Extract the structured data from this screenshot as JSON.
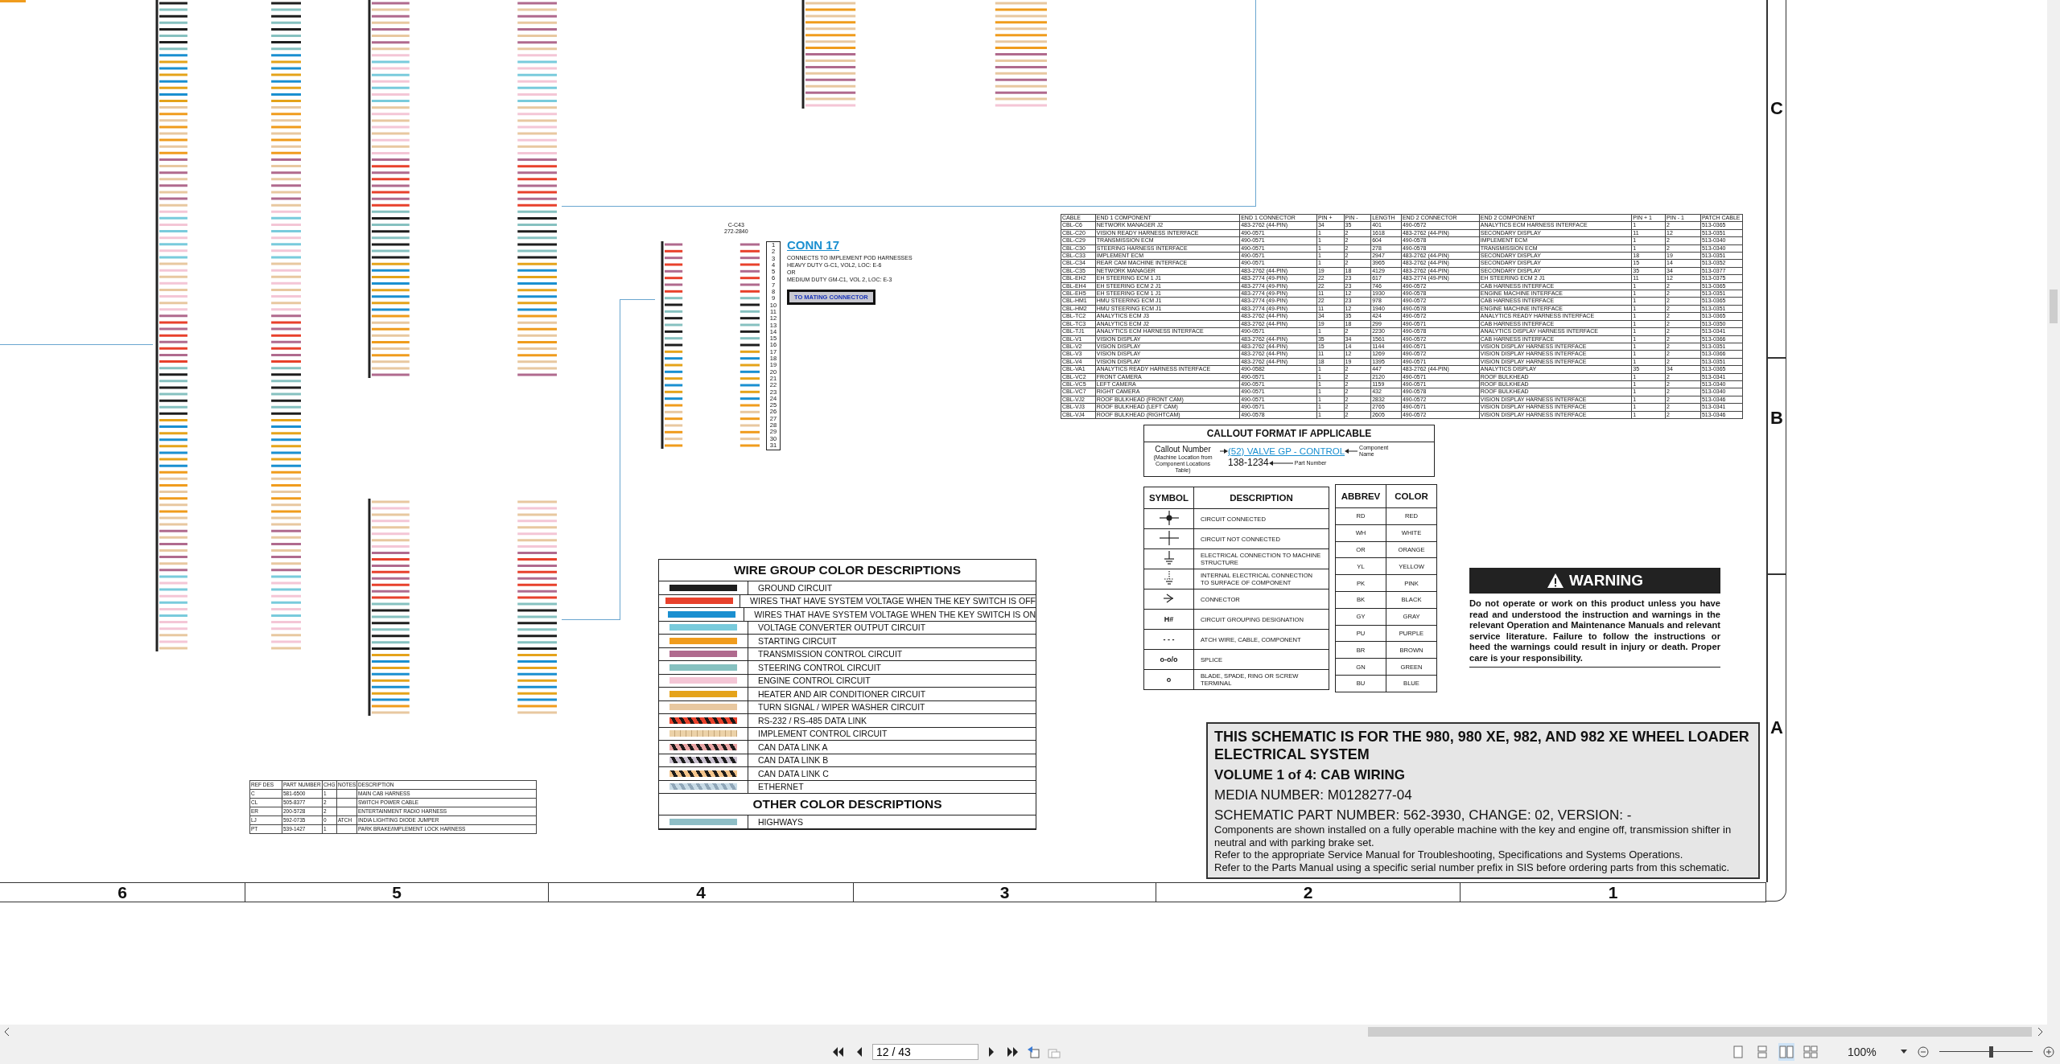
{
  "sheet": {
    "row_letters": [
      "C",
      "B",
      "A"
    ],
    "column_numbers": [
      "6",
      "5",
      "4",
      "3",
      "2",
      "1"
    ],
    "connector": {
      "ref": "C-C43",
      "part": "272-2840",
      "title": "CONN 17",
      "lines": [
        "CONNECTS TO IMPLEMENT POD HARNESSES",
        "HEAVY DUTY G-C1, VOL2, LOC: E-6",
        "OR",
        "MEDIUM DUTY GM-C1, VOL 2, LOC: E-3"
      ],
      "button": "TO MATING CONNECTOR",
      "pins": [
        "1",
        "2",
        "3",
        "4",
        "5",
        "6",
        "7",
        "8",
        "9",
        "10",
        "11",
        "12",
        "13",
        "14",
        "15",
        "16",
        "17",
        "18",
        "19",
        "20",
        "21",
        "22",
        "23",
        "24",
        "25",
        "26",
        "27",
        "28",
        "29",
        "30",
        "31"
      ]
    },
    "cable_table": {
      "columns": [
        "CABLE",
        "END 1 COMPONENT",
        "END 1 CONNECTOR",
        "PIN +",
        "PIN -",
        "LENGTH",
        "END 2 CONNECTOR",
        "END 2 COMPONENT",
        "PIN + 1",
        "PIN - 1",
        "PATCH CABLE"
      ],
      "rows": [
        [
          "CBL-C6",
          "NETWORK MANAGER J2",
          "483-2762 (44-PIN)",
          "34",
          "35",
          "401",
          "490-0572",
          "ANALYTICS ECM HARNESS INTERFACE",
          "1",
          "2",
          "513-0365"
        ],
        [
          "CBL-C20",
          "VISION READY HARNESS INTERFACE",
          "490-0571",
          "1",
          "2",
          "1618",
          "483-2762 (44-PIN)",
          "SECONDARY DISPLAY",
          "11",
          "12",
          "513-0351"
        ],
        [
          "CBL-C29",
          "TRANSMISSION ECM",
          "490-0571",
          "1",
          "2",
          "604",
          "490-0578",
          "IMPLEMENT ECM",
          "1",
          "2",
          "513-0340"
        ],
        [
          "CBL-C30",
          "STEERING HARNESS INTERFACE",
          "490-0571",
          "1",
          "2",
          "278",
          "490-0578",
          "TRANSMISSION ECM",
          "1",
          "2",
          "513-0340"
        ],
        [
          "CBL-C33",
          "IMPLEMENT ECM",
          "490-0571",
          "1",
          "2",
          "2947",
          "483-2762 (44-PIN)",
          "SECONDARY DISPLAY",
          "18",
          "19",
          "513-0351"
        ],
        [
          "CBL-C34",
          "REAR CAM MACHINE INTERFACE",
          "490-0571",
          "1",
          "2",
          "3965",
          "483-2762 (44-PIN)",
          "SECONDARY DISPLAY",
          "15",
          "14",
          "513-0352"
        ],
        [
          "CBL-C35",
          "NETWORK MANAGER",
          "483-2762 (44-PIN)",
          "19",
          "18",
          "4129",
          "483-2762 (44-PIN)",
          "SECONDARY DISPLAY",
          "35",
          "34",
          "513-0377"
        ],
        [
          "CBL-EH2",
          "EH STEERING ECM 1 J1",
          "483-2774 (49-PIN)",
          "22",
          "23",
          "617",
          "483-2774 (49-PIN)",
          "EH STEERING ECM 2 J1",
          "11",
          "12",
          "513-0375"
        ],
        [
          "CBL-EH4",
          "EH STEERING ECM 2 J1",
          "483-2774 (49-PIN)",
          "22",
          "23",
          "746",
          "490-0572",
          "CAB HARNESS INTERFACE",
          "1",
          "2",
          "513-0365"
        ],
        [
          "CBL-EH5",
          "EH STEERING ECM 1 J1",
          "483-2774 (49-PIN)",
          "11",
          "12",
          "1930",
          "490-0578",
          "ENGINE MACHINE INTERFACE",
          "1",
          "2",
          "513-0351"
        ],
        [
          "CBL-HM1",
          "HMU STEERING ECM J1",
          "483-2774 (49-PIN)",
          "22",
          "23",
          "978",
          "490-0572",
          "CAB HARNESS INTERFACE",
          "1",
          "2",
          "513-0365"
        ],
        [
          "CBL-HM2",
          "HMU STEERING ECM J1",
          "483-2774 (49-PIN)",
          "11",
          "12",
          "1940",
          "490-0578",
          "ENGINE MACHINE INTERFACE",
          "1",
          "2",
          "513-0351"
        ],
        [
          "CBL-TC2",
          "ANALYTICS ECM J3",
          "483-2762 (44-PIN)",
          "34",
          "35",
          "424",
          "490-0572",
          "ANALYTICS READY HARNESS INTERFACE",
          "1",
          "2",
          "513-0365"
        ],
        [
          "CBL-TC3",
          "ANALYTICS ECM J2",
          "483-2762 (44-PIN)",
          "19",
          "18",
          "299",
          "490-0571",
          "CAB HARNESS INTERFACE",
          "1",
          "2",
          "513-0350"
        ],
        [
          "CBL-TJ1",
          "ANALYTICS ECM HARNESS INTERFACE",
          "490-0571",
          "1",
          "2",
          "2230",
          "490-0578",
          "ANALYTICS DISPLAY HARNESS INTERFACE",
          "1",
          "2",
          "513-0341"
        ],
        [
          "CBL-V1",
          "VISION DISPLAY",
          "483-2762 (44-PIN)",
          "35",
          "34",
          "1561",
          "490-0572",
          "CAB HARNESS INTERFACE",
          "1",
          "2",
          "513-0366"
        ],
        [
          "CBL-V2",
          "VISION DISPLAY",
          "483-2762 (44-PIN)",
          "15",
          "14",
          "1144",
          "490-0571",
          "VISION DISPLAY HARNESS INTERFACE",
          "1",
          "2",
          "513-0351"
        ],
        [
          "CBL-V3",
          "VISION DISPLAY",
          "483-2762 (44-PIN)",
          "11",
          "12",
          "1269",
          "490-0572",
          "VISION DISPLAY HARNESS INTERFACE",
          "1",
          "2",
          "513-0366"
        ],
        [
          "CBL-V4",
          "VISION DISPLAY",
          "483-2762 (44-PIN)",
          "18",
          "19",
          "1395",
          "490-0571",
          "VISION DISPLAY HARNESS INTERFACE",
          "1",
          "2",
          "513-0351"
        ],
        [
          "CBL-VA1",
          "ANALYTICS READY HARNESS INTERFACE",
          "490-0582",
          "1",
          "2",
          "447",
          "483-2762 (44-PIN)",
          "ANALYTICS DISPLAY",
          "35",
          "34",
          "513-0365"
        ],
        [
          "CBL-VC2",
          "FRONT CAMERA",
          "490-0571",
          "1",
          "2",
          "2120",
          "490-0571",
          "ROOF BULKHEAD",
          "1",
          "2",
          "513-0341"
        ],
        [
          "CBL-VC5",
          "LEFT CAMERA",
          "490-0571",
          "1",
          "2",
          "1159",
          "490-0571",
          "ROOF BULKHEAD",
          "1",
          "2",
          "513-0340"
        ],
        [
          "CBL-VC7",
          "RIGHT CAMERA",
          "490-0571",
          "1",
          "2",
          "432",
          "490-0578",
          "ROOF BULKHEAD",
          "1",
          "2",
          "513-0340"
        ],
        [
          "CBL-VJ2",
          "ROOF BULKHEAD (FRONT CAM)",
          "490-0571",
          "1",
          "2",
          "2832",
          "490-0572",
          "VISION DISPLAY HARNESS INTERFACE",
          "1",
          "2",
          "513-0346"
        ],
        [
          "CBL-VJ3",
          "ROOF BULKHEAD (LEFT CAM)",
          "490-0571",
          "1",
          "2",
          "2765",
          "490-0571",
          "VISION DISPLAY HARNESS INTERFACE",
          "1",
          "2",
          "513-0341"
        ],
        [
          "CBL-VJ4",
          "ROOF BULKHEAD (RIGHTCAM)",
          "490-0578",
          "1",
          "2",
          "2605",
          "490-0572",
          "VISION DISPLAY HARNESS INTERFACE",
          "1",
          "2",
          "513-0346"
        ]
      ]
    },
    "callout": {
      "title": "CALLOUT FORMAT IF APPLICABLE",
      "callout_label": "Callout Number",
      "callout_note": "(Machine Location from Component Locations Table)",
      "link": "(52) VALVE GP - CONTROL",
      "component_label": "Component Name",
      "part": "138-1234",
      "part_label": "Part Number"
    },
    "symbols": {
      "columns": [
        "SYMBOL",
        "DESCRIPTION"
      ],
      "rows": [
        {
          "kind": "connected",
          "description": "CIRCUIT CONNECTED"
        },
        {
          "kind": "not-connected",
          "description": "CIRCUIT NOT CONNECTED"
        },
        {
          "kind": "ground",
          "description": "ELECTRICAL CONNECTION TO MACHINE STRUCTURE"
        },
        {
          "kind": "internal-ground",
          "description": "INTERNAL ELECTRICAL CONNECTION TO SURFACE OF COMPONENT"
        },
        {
          "kind": "connector",
          "description": "CONNECTOR"
        },
        {
          "kind": "text",
          "symbol": "H#",
          "description": "CIRCUIT GROUPING DESIGNATION"
        },
        {
          "kind": "text",
          "symbol": "- - -",
          "description": "ATCH WIRE, CABLE, COMPONENT"
        },
        {
          "kind": "text",
          "symbol": "o-o/o",
          "description": "SPLICE"
        },
        {
          "kind": "text",
          "symbol": "o",
          "description": "BLADE, SPADE, RING OR SCREW TERMINAL"
        }
      ]
    },
    "abbreviations": {
      "columns": [
        "ABBREV",
        "COLOR"
      ],
      "rows": [
        [
          "RD",
          "RED"
        ],
        [
          "WH",
          "WHITE"
        ],
        [
          "OR",
          "ORANGE"
        ],
        [
          "YL",
          "YELLOW"
        ],
        [
          "PK",
          "PINK"
        ],
        [
          "BK",
          "BLACK"
        ],
        [
          "GY",
          "GRAY"
        ],
        [
          "PU",
          "PURPLE"
        ],
        [
          "BR",
          "BROWN"
        ],
        [
          "GN",
          "GREEN"
        ],
        [
          "BU",
          "BLUE"
        ]
      ]
    },
    "warning": {
      "title": "WARNING",
      "text": "Do not operate or work on this product unless you have read and understood the instruction and warnings in the relevant Operation and Maintenance Manuals and relevant service literature. Failure to follow the instructions or heed the warnings could result in injury or death. Proper care is your responsibility."
    },
    "wire_groups": {
      "title": "WIRE GROUP COLOR DESCRIPTIONS",
      "items": [
        {
          "kind": "solid",
          "color": "#1e1e1e",
          "label": "GROUND CIRCUIT"
        },
        {
          "kind": "solid",
          "color": "#e8412c",
          "label": "WIRES THAT HAVE SYSTEM VOLTAGE WHEN THE KEY SWITCH IS OFF"
        },
        {
          "kind": "solid",
          "color": "#1a8fd0",
          "label": "WIRES THAT HAVE SYSTEM VOLTAGE WHEN THE KEY SWITCH IS ON"
        },
        {
          "kind": "solid",
          "color": "#79cbdc",
          "label": "VOLTAGE CONVERTER OUTPUT CIRCUIT"
        },
        {
          "kind": "solid",
          "color": "#f09c1d",
          "label": "STARTING CIRCUIT"
        },
        {
          "kind": "solid",
          "color": "#b06a8e",
          "label": "TRANSMISSION CONTROL CIRCUIT"
        },
        {
          "kind": "solid",
          "color": "#86c1c0",
          "label": "STEERING CONTROL CIRCUIT"
        },
        {
          "kind": "solid",
          "color": "#f4c6d6",
          "label": "ENGINE CONTROL CIRCUIT"
        },
        {
          "kind": "solid",
          "color": "#e5a31a",
          "label": "HEATER AND AIR CONDITIONER CIRCUIT"
        },
        {
          "kind": "solid",
          "color": "#e8c8a0",
          "label": "TURN SIGNAL / WIPER WASHER CIRCUIT"
        },
        {
          "kind": "hatched",
          "color": "#e8412c",
          "label": "RS-232 / RS-485 DATA LINK"
        },
        {
          "kind": "dotted",
          "color": "#ecd2a8",
          "label": "IMPLEMENT CONTROL CIRCUIT"
        },
        {
          "kind": "hatched",
          "color": "#e9a4a4",
          "label": "CAN DATA LINK A"
        },
        {
          "kind": "hatched",
          "color": "#c9c0cf",
          "label": "CAN DATA LINK B"
        },
        {
          "kind": "hatched",
          "color": "#f4c58c",
          "label": "CAN DATA LINK C"
        },
        {
          "kind": "light-hatched",
          "color": "#c8dbe6",
          "label": "ETHERNET"
        }
      ],
      "other_title": "OTHER COLOR DESCRIPTIONS",
      "other_items": [
        {
          "kind": "solid",
          "color": "#8fbec6",
          "label": "HIGHWAYS"
        }
      ]
    },
    "parts_table": {
      "columns": [
        "REF DES",
        "PART NUMBER",
        "CHG",
        "NOTES",
        "DESCRIPTION"
      ],
      "rows": [
        [
          "C",
          "581-6500",
          "1",
          "",
          "MAIN CAB HARNESS"
        ],
        [
          "CL",
          "505-8377",
          "2",
          "",
          "SWITCH POWER CABLE"
        ],
        [
          "ER",
          "200-5728",
          "2",
          "",
          "ENTERTAINMENT RADIO HARNESS"
        ],
        [
          "LJ",
          "592-0735",
          "0",
          "ATCH",
          "INDIA LIGHTING DIODE JUMPER"
        ],
        [
          "PT",
          "539-1427",
          "1",
          "",
          "PARK BRAKE/IMPLEMENT LOCK HARNESS"
        ]
      ]
    },
    "title_block": {
      "heading": "THIS SCHEMATIC IS FOR THE 980, 980 XE, 982, AND 982 XE WHEEL LOADER ELECTRICAL SYSTEM",
      "volume": "VOLUME 1 of 4: CAB WIRING",
      "media": "MEDIA NUMBER: M0128277-04",
      "part": "SCHEMATIC PART NUMBER: 562-3930, CHANGE: 02, VERSION: -",
      "notes": [
        "Components are shown installed on a fully operable machine with the key and engine off, transmission shifter in neutral and with parking brake set.",
        "Refer to the appropriate Service Manual for Troubleshooting, Specifications and Systems Operations.",
        "Refer to the Parts Manual using a specific serial number prefix in SIS before ordering parts from this schematic."
      ]
    }
  },
  "toolbar": {
    "page": "12 / 43",
    "zoom": "100%",
    "zoom_slider": {
      "level": 0.55
    }
  }
}
